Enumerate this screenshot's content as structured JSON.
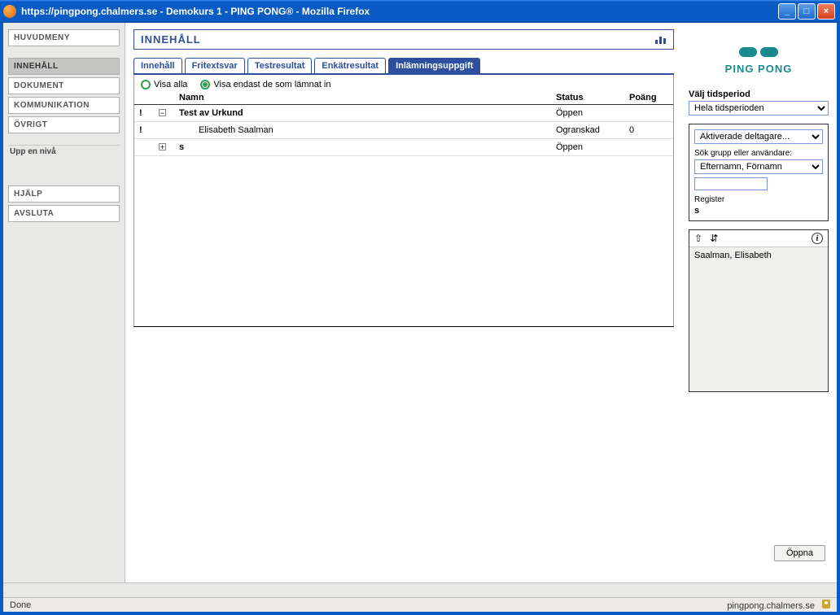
{
  "window": {
    "title": "https://pingpong.chalmers.se - Demokurs 1 - PING PONG® - Mozilla Firefox"
  },
  "sidebar": {
    "mainmenu": "HUVUDMENY",
    "items": [
      {
        "label": "INNEHÅLL",
        "active": true
      },
      {
        "label": "DOKUMENT",
        "active": false
      },
      {
        "label": "KOMMUNIKATION",
        "active": false
      },
      {
        "label": "ÖVRIGT",
        "active": false
      }
    ],
    "uplevel": "Upp en nivå",
    "help": "HJÄLP",
    "quit": "AVSLUTA"
  },
  "content": {
    "title": "INNEHÅLL",
    "tabs": [
      "Innehåll",
      "Fritextsvar",
      "Testresultat",
      "Enkätresultat",
      "Inlämningsuppgift"
    ],
    "active_tab_index": 4,
    "filters": {
      "show_all": "Visa alla",
      "show_submitted": "Visa endast de som lämnat in"
    },
    "columns": {
      "name": "Namn",
      "status": "Status",
      "points": "Poäng"
    },
    "rows": [
      {
        "marker": "!",
        "toggle": "−",
        "name": "Test av Urkund",
        "bold": true,
        "status": "Öppen",
        "points": ""
      },
      {
        "marker": "!",
        "toggle": "",
        "name": "Elisabeth Saalman",
        "bold": false,
        "indent": true,
        "status": "Ogranskad",
        "points": "0"
      },
      {
        "marker": "",
        "toggle": "+",
        "name": "s",
        "bold": true,
        "status": "Öppen",
        "points": ""
      }
    ]
  },
  "right": {
    "brand": "PING PONG",
    "period_label": "Välj tidsperiod",
    "period_value": "Hela tidsperioden",
    "participants_value": "Aktiverade deltagare...",
    "search_label": "Sök grupp eller användare:",
    "sort_value": "Efternamn, Förnamn",
    "register": "Register",
    "register_letter": "s",
    "list_item": "Saalman, Elisabeth",
    "info_char": "i"
  },
  "buttons": {
    "open": "Öppna"
  },
  "status": {
    "left": "Done",
    "right": "pingpong.chalmers.se"
  }
}
